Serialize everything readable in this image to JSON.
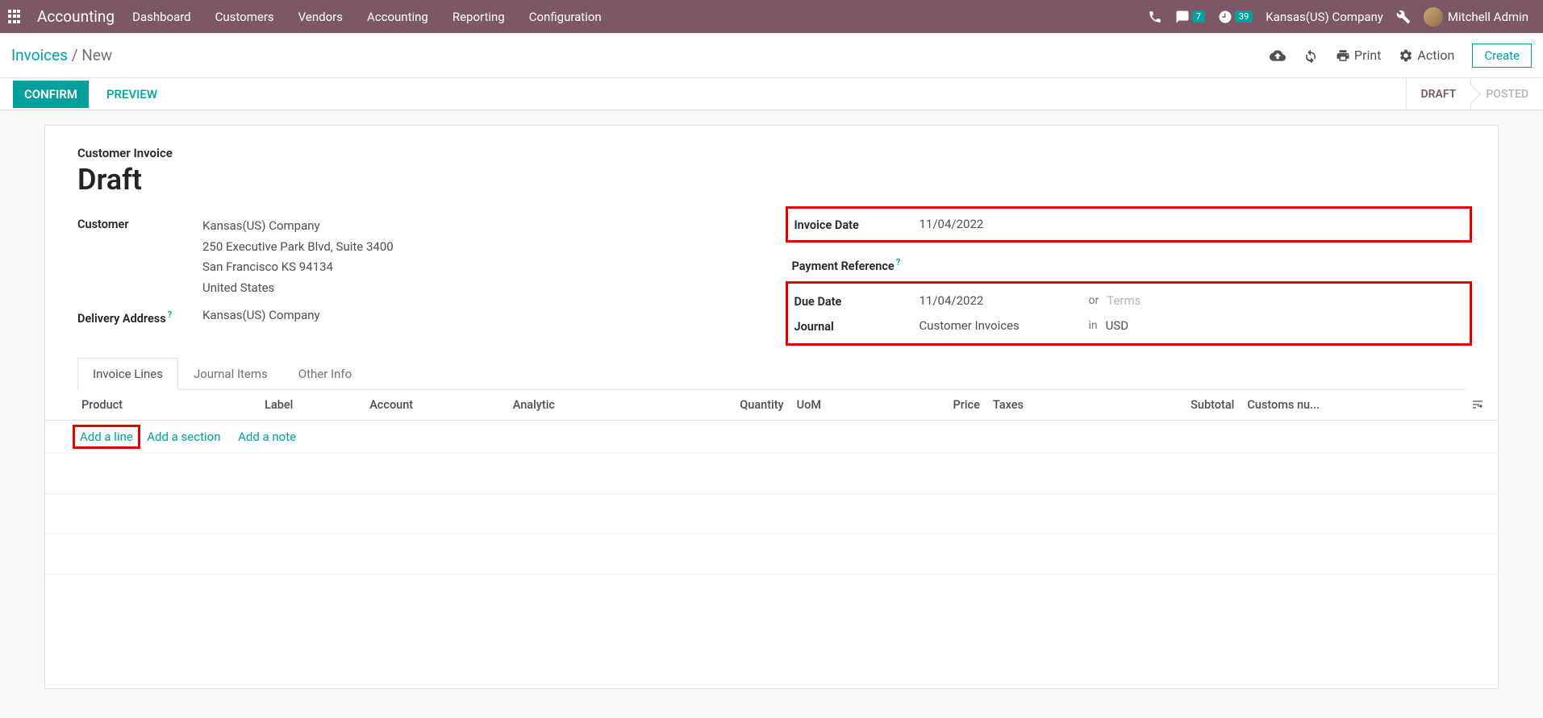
{
  "topbar": {
    "app_title": "Accounting",
    "menu": [
      "Dashboard",
      "Customers",
      "Vendors",
      "Accounting",
      "Reporting",
      "Configuration"
    ],
    "chat_badge": "7",
    "clock_badge": "39",
    "company": "Kansas(US) Company",
    "user": "Mitchell Admin"
  },
  "subbar": {
    "breadcrumb_root": "Invoices",
    "breadcrumb_current": "New",
    "print_label": "Print",
    "action_label": "Action",
    "create_label": "Create"
  },
  "actionbar": {
    "confirm": "CONFIRM",
    "preview": "PREVIEW",
    "status_draft": "DRAFT",
    "status_posted": "POSTED"
  },
  "form": {
    "subtitle": "Customer Invoice",
    "title": "Draft",
    "left": {
      "customer_label": "Customer",
      "customer_name": "Kansas(US) Company",
      "addr1": "250 Executive Park Blvd, Suite 3400",
      "addr2": "San Francisco KS 94134",
      "addr3": "United States",
      "delivery_label": "Delivery Address",
      "delivery_value": "Kansas(US) Company"
    },
    "right": {
      "invoice_date_label": "Invoice Date",
      "invoice_date_value": "11/04/2022",
      "payment_ref_label": "Payment Reference",
      "due_date_label": "Due Date",
      "due_date_value": "11/04/2022",
      "or_text": "or",
      "terms_placeholder": "Terms",
      "journal_label": "Journal",
      "journal_value": "Customer Invoices",
      "in_text": "in",
      "currency_value": "USD"
    }
  },
  "tabs": {
    "invoice_lines": "Invoice Lines",
    "journal_items": "Journal Items",
    "other_info": "Other Info"
  },
  "table": {
    "headers": {
      "product": "Product",
      "label": "Label",
      "account": "Account",
      "analytic": "Analytic",
      "quantity": "Quantity",
      "uom": "UoM",
      "price": "Price",
      "taxes": "Taxes",
      "subtotal": "Subtotal",
      "customs": "Customs nu..."
    },
    "add_line": "Add a line",
    "add_section": "Add a section",
    "add_note": "Add a note"
  }
}
